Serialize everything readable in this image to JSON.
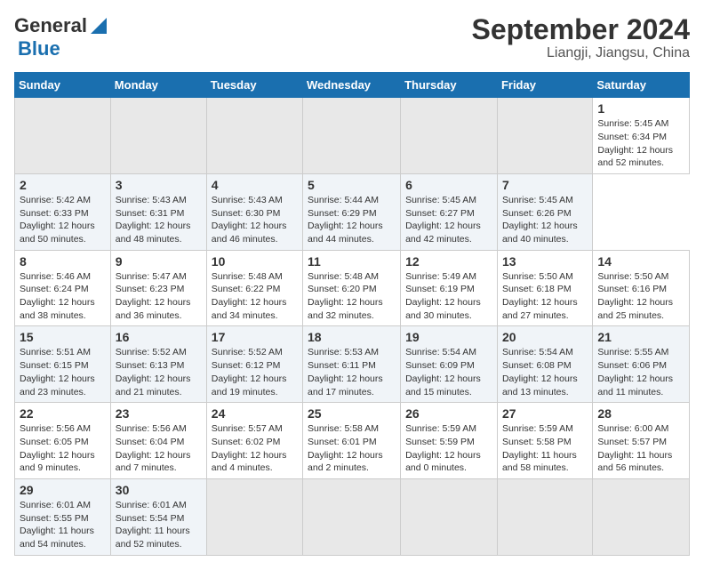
{
  "header": {
    "logo_line1": "General",
    "logo_line2": "Blue",
    "title": "September 2024",
    "subtitle": "Liangji, Jiangsu, China"
  },
  "calendar": {
    "days_of_week": [
      "Sunday",
      "Monday",
      "Tuesday",
      "Wednesday",
      "Thursday",
      "Friday",
      "Saturday"
    ],
    "weeks": [
      [
        {
          "day": "",
          "empty": true
        },
        {
          "day": "",
          "empty": true
        },
        {
          "day": "",
          "empty": true
        },
        {
          "day": "",
          "empty": true
        },
        {
          "day": "",
          "empty": true
        },
        {
          "day": "",
          "empty": true
        },
        {
          "day": "1",
          "sunrise": "Sunrise: 5:45 AM",
          "sunset": "Sunset: 6:34 PM",
          "daylight": "Daylight: 12 hours and 52 minutes."
        }
      ],
      [
        {
          "day": "2",
          "sunrise": "Sunrise: 5:42 AM",
          "sunset": "Sunset: 6:33 PM",
          "daylight": "Daylight: 12 hours and 50 minutes."
        },
        {
          "day": "3",
          "sunrise": "Sunrise: 5:43 AM",
          "sunset": "Sunset: 6:31 PM",
          "daylight": "Daylight: 12 hours and 48 minutes."
        },
        {
          "day": "4",
          "sunrise": "Sunrise: 5:43 AM",
          "sunset": "Sunset: 6:30 PM",
          "daylight": "Daylight: 12 hours and 46 minutes."
        },
        {
          "day": "5",
          "sunrise": "Sunrise: 5:44 AM",
          "sunset": "Sunset: 6:29 PM",
          "daylight": "Daylight: 12 hours and 44 minutes."
        },
        {
          "day": "6",
          "sunrise": "Sunrise: 5:45 AM",
          "sunset": "Sunset: 6:27 PM",
          "daylight": "Daylight: 12 hours and 42 minutes."
        },
        {
          "day": "7",
          "sunrise": "Sunrise: 5:45 AM",
          "sunset": "Sunset: 6:26 PM",
          "daylight": "Daylight: 12 hours and 40 minutes."
        }
      ],
      [
        {
          "day": "8",
          "sunrise": "Sunrise: 5:46 AM",
          "sunset": "Sunset: 6:24 PM",
          "daylight": "Daylight: 12 hours and 38 minutes."
        },
        {
          "day": "9",
          "sunrise": "Sunrise: 5:47 AM",
          "sunset": "Sunset: 6:23 PM",
          "daylight": "Daylight: 12 hours and 36 minutes."
        },
        {
          "day": "10",
          "sunrise": "Sunrise: 5:48 AM",
          "sunset": "Sunset: 6:22 PM",
          "daylight": "Daylight: 12 hours and 34 minutes."
        },
        {
          "day": "11",
          "sunrise": "Sunrise: 5:48 AM",
          "sunset": "Sunset: 6:20 PM",
          "daylight": "Daylight: 12 hours and 32 minutes."
        },
        {
          "day": "12",
          "sunrise": "Sunrise: 5:49 AM",
          "sunset": "Sunset: 6:19 PM",
          "daylight": "Daylight: 12 hours and 30 minutes."
        },
        {
          "day": "13",
          "sunrise": "Sunrise: 5:50 AM",
          "sunset": "Sunset: 6:18 PM",
          "daylight": "Daylight: 12 hours and 27 minutes."
        },
        {
          "day": "14",
          "sunrise": "Sunrise: 5:50 AM",
          "sunset": "Sunset: 6:16 PM",
          "daylight": "Daylight: 12 hours and 25 minutes."
        }
      ],
      [
        {
          "day": "15",
          "sunrise": "Sunrise: 5:51 AM",
          "sunset": "Sunset: 6:15 PM",
          "daylight": "Daylight: 12 hours and 23 minutes."
        },
        {
          "day": "16",
          "sunrise": "Sunrise: 5:52 AM",
          "sunset": "Sunset: 6:13 PM",
          "daylight": "Daylight: 12 hours and 21 minutes."
        },
        {
          "day": "17",
          "sunrise": "Sunrise: 5:52 AM",
          "sunset": "Sunset: 6:12 PM",
          "daylight": "Daylight: 12 hours and 19 minutes."
        },
        {
          "day": "18",
          "sunrise": "Sunrise: 5:53 AM",
          "sunset": "Sunset: 6:11 PM",
          "daylight": "Daylight: 12 hours and 17 minutes."
        },
        {
          "day": "19",
          "sunrise": "Sunrise: 5:54 AM",
          "sunset": "Sunset: 6:09 PM",
          "daylight": "Daylight: 12 hours and 15 minutes."
        },
        {
          "day": "20",
          "sunrise": "Sunrise: 5:54 AM",
          "sunset": "Sunset: 6:08 PM",
          "daylight": "Daylight: 12 hours and 13 minutes."
        },
        {
          "day": "21",
          "sunrise": "Sunrise: 5:55 AM",
          "sunset": "Sunset: 6:06 PM",
          "daylight": "Daylight: 12 hours and 11 minutes."
        }
      ],
      [
        {
          "day": "22",
          "sunrise": "Sunrise: 5:56 AM",
          "sunset": "Sunset: 6:05 PM",
          "daylight": "Daylight: 12 hours and 9 minutes."
        },
        {
          "day": "23",
          "sunrise": "Sunrise: 5:56 AM",
          "sunset": "Sunset: 6:04 PM",
          "daylight": "Daylight: 12 hours and 7 minutes."
        },
        {
          "day": "24",
          "sunrise": "Sunrise: 5:57 AM",
          "sunset": "Sunset: 6:02 PM",
          "daylight": "Daylight: 12 hours and 4 minutes."
        },
        {
          "day": "25",
          "sunrise": "Sunrise: 5:58 AM",
          "sunset": "Sunset: 6:01 PM",
          "daylight": "Daylight: 12 hours and 2 minutes."
        },
        {
          "day": "26",
          "sunrise": "Sunrise: 5:59 AM",
          "sunset": "Sunset: 5:59 PM",
          "daylight": "Daylight: 12 hours and 0 minutes."
        },
        {
          "day": "27",
          "sunrise": "Sunrise: 5:59 AM",
          "sunset": "Sunset: 5:58 PM",
          "daylight": "Daylight: 11 hours and 58 minutes."
        },
        {
          "day": "28",
          "sunrise": "Sunrise: 6:00 AM",
          "sunset": "Sunset: 5:57 PM",
          "daylight": "Daylight: 11 hours and 56 minutes."
        }
      ],
      [
        {
          "day": "29",
          "sunrise": "Sunrise: 6:01 AM",
          "sunset": "Sunset: 5:55 PM",
          "daylight": "Daylight: 11 hours and 54 minutes."
        },
        {
          "day": "30",
          "sunrise": "Sunrise: 6:01 AM",
          "sunset": "Sunset: 5:54 PM",
          "daylight": "Daylight: 11 hours and 52 minutes."
        },
        {
          "day": "",
          "empty": true
        },
        {
          "day": "",
          "empty": true
        },
        {
          "day": "",
          "empty": true
        },
        {
          "day": "",
          "empty": true
        },
        {
          "day": "",
          "empty": true
        }
      ]
    ]
  }
}
